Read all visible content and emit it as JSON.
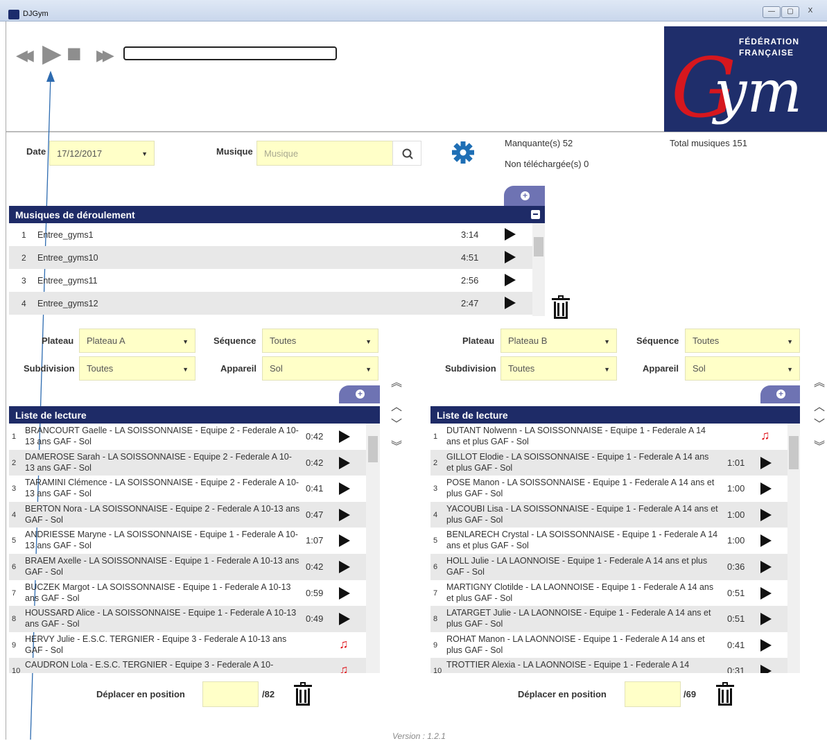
{
  "window": {
    "title": "DJGym",
    "minimize": "—",
    "maximize": "▢",
    "close": "X"
  },
  "player": {
    "rewind": "◀◀",
    "play": "▶",
    "stop": "■",
    "forward": "▶▶"
  },
  "logo": {
    "line1": "FÉDÉRATION",
    "line2": "FRANÇAISE",
    "letter": "G",
    "rest": "ym"
  },
  "filters": {
    "date_label": "Date",
    "date_value": "17/12/2017",
    "music_label": "Musique",
    "music_placeholder": "Musique"
  },
  "stats": {
    "missing": "Manquante(s) 52",
    "not_downloaded": "Non téléchargée(s) 0",
    "total": "Total musiques 151"
  },
  "program": {
    "title": "Musiques de déroulement",
    "rows": [
      {
        "n": "1",
        "name": "Entree_gyms1",
        "dur": "3:14"
      },
      {
        "n": "2",
        "name": "Entree_gyms10",
        "dur": "4:51"
      },
      {
        "n": "3",
        "name": "Entree_gyms11",
        "dur": "2:56"
      },
      {
        "n": "4",
        "name": "Entree_gyms12",
        "dur": "2:47"
      }
    ]
  },
  "left": {
    "plateau_label": "Plateau",
    "plateau": "Plateau A",
    "sequence_label": "Séquence",
    "sequence": "Toutes",
    "subdivision_label": "Subdivision",
    "subdivision": "Toutes",
    "appareil_label": "Appareil",
    "appareil": "Sol",
    "list_title": "Liste de lecture",
    "move_label": "Déplacer en position",
    "total": "/82",
    "rows": [
      {
        "n": "1",
        "t": "BRANCOURT Gaelle - LA SOISSONNAISE - Equipe 2 - Federale A 10-13 ans GAF - Sol",
        "d": "0:42",
        "p": "play"
      },
      {
        "n": "2",
        "t": "DAMEROSE Sarah - LA SOISSONNAISE - Equipe 2 - Federale A 10-13 ans GAF - Sol",
        "d": "0:42",
        "p": "play"
      },
      {
        "n": "3",
        "t": "TARAMINI Clémence - LA SOISSONNAISE - Equipe 2 - Federale A 10-13 ans GAF - Sol",
        "d": "0:41",
        "p": "play"
      },
      {
        "n": "4",
        "t": "BERTON Nora - LA SOISSONNAISE - Equipe 2 - Federale A 10-13 ans GAF - Sol",
        "d": "0:47",
        "p": "play"
      },
      {
        "n": "5",
        "t": "ANDRIESSE Maryne - LA SOISSONNAISE - Equipe 1 - Federale A 10-13 ans GAF - Sol",
        "d": "1:07",
        "p": "play"
      },
      {
        "n": "6",
        "t": "BRAEM Axelle - LA SOISSONNAISE - Equipe 1 - Federale A 10-13 ans GAF - Sol",
        "d": "0:42",
        "p": "play"
      },
      {
        "n": "7",
        "t": "BUCZEK Margot - LA SOISSONNAISE - Equipe 1 - Federale A 10-13 ans GAF - Sol",
        "d": "0:59",
        "p": "play"
      },
      {
        "n": "8",
        "t": "HOUSSARD Alice - LA SOISSONNAISE - Equipe 1 - Federale A 10-13 ans GAF - Sol",
        "d": "0:49",
        "p": "play"
      },
      {
        "n": "9",
        "t": "HERVY Julie - E.S.C. TERGNIER - Equipe 3 - Federale A 10-13 ans GAF - Sol",
        "d": "",
        "p": "note"
      },
      {
        "n": "10",
        "t": "CAUDRON Lola - E.S.C. TERGNIER - Equipe 3 - Federale A 10-",
        "d": "",
        "p": "note"
      }
    ]
  },
  "right": {
    "plateau_label": "Plateau",
    "plateau": "Plateau B",
    "sequence_label": "Séquence",
    "sequence": "Toutes",
    "subdivision_label": "Subdivision",
    "subdivision": "Toutes",
    "appareil_label": "Appareil",
    "appareil": "Sol",
    "list_title": "Liste de lecture",
    "move_label": "Déplacer en position",
    "total": "/69",
    "rows": [
      {
        "n": "1",
        "t": "DUTANT Nolwenn - LA SOISSONNAISE - Equipe 1 - Federale A 14 ans et plus GAF - Sol",
        "d": "",
        "p": "note"
      },
      {
        "n": "2",
        "t": "GILLOT Elodie - LA SOISSONNAISE - Equipe 1 - Federale A 14 ans et plus GAF - Sol",
        "d": "1:01",
        "p": "play"
      },
      {
        "n": "3",
        "t": "POSE Manon - LA SOISSONNAISE - Equipe 1 - Federale A 14 ans et plus GAF - Sol",
        "d": "1:00",
        "p": "play"
      },
      {
        "n": "4",
        "t": "YACOUBI Lisa - LA SOISSONNAISE - Equipe 1 - Federale A 14 ans et plus GAF - Sol",
        "d": "1:00",
        "p": "play"
      },
      {
        "n": "5",
        "t": "BENLARECH Crystal - LA SOISSONNAISE - Equipe 1 - Federale A 14 ans et plus GAF - Sol",
        "d": "1:00",
        "p": "play"
      },
      {
        "n": "6",
        "t": "HOLL Julie - LA LAONNOISE - Equipe 1 - Federale A 14 ans et plus GAF - Sol",
        "d": "0:36",
        "p": "play"
      },
      {
        "n": "7",
        "t": "MARTIGNY Clotilde - LA LAONNOISE - Equipe 1 - Federale A 14 ans et plus GAF - Sol",
        "d": "0:51",
        "p": "play"
      },
      {
        "n": "8",
        "t": "LATARGET Julie - LA LAONNOISE - Equipe 1 - Federale A 14 ans et plus GAF - Sol",
        "d": "0:51",
        "p": "play"
      },
      {
        "n": "9",
        "t": "ROHAT Manon - LA LAONNOISE - Equipe 1 - Federale A 14 ans et plus GAF - Sol",
        "d": "0:41",
        "p": "play"
      },
      {
        "n": "10",
        "t": "TROTTIER Alexia - LA LAONNOISE - Equipe 1 - Federale A 14",
        "d": "0:31",
        "p": "play"
      }
    ]
  },
  "footer": {
    "version": "Version : 1.2.1"
  },
  "icons": {
    "search": "search-icon",
    "settings": "gear-icon",
    "trash": "trash-icon",
    "plus": "+",
    "note": "♫",
    "caret": "▼",
    "top": "︽",
    "up": "︿",
    "down": "﹀",
    "bottom": "︾"
  },
  "colors": {
    "header": "#1e2b67",
    "tab": "#6e73b3",
    "field": "#ffffc8",
    "note": "#e0141c",
    "settings": "#1f6fb5"
  }
}
